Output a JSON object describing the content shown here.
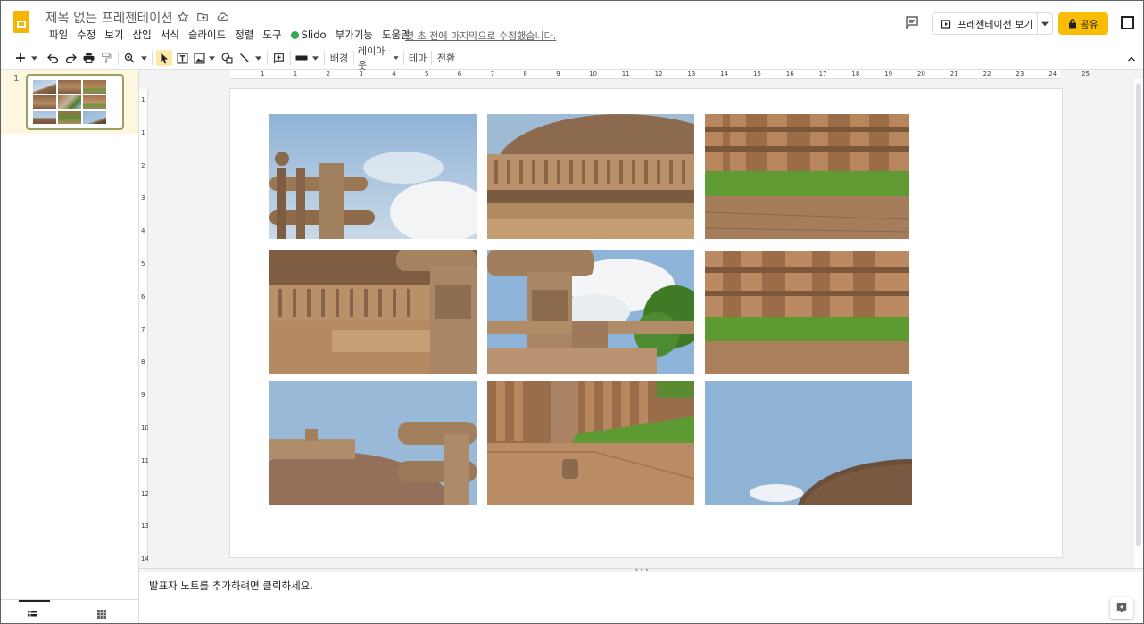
{
  "app": {
    "document_title": "제목 없는 프레젠테이션",
    "last_edit": "몇 초 전에 마지막으로 수정했습니다."
  },
  "menu": [
    "파일",
    "수정",
    "보기",
    "삽입",
    "서식",
    "슬라이드",
    "정렬",
    "도구",
    "Slido",
    "부가기능",
    "도움말"
  ],
  "header_buttons": {
    "present_label": "프레젠테이션 보기",
    "share_label": "공유"
  },
  "toolbar": {
    "background_label": "배경",
    "layout_label": "레이아웃",
    "theme_label": "테마",
    "transition_label": "전환"
  },
  "filmstrip": {
    "slide_number": "1"
  },
  "rulers": {
    "horizontal": [
      "1",
      "1",
      "2",
      "3",
      "4",
      "5",
      "6",
      "7",
      "8",
      "9",
      "10",
      "11",
      "12",
      "13",
      "14",
      "15",
      "16",
      "17",
      "18",
      "19",
      "20",
      "21",
      "22",
      "23",
      "24",
      "25"
    ],
    "vertical": [
      "1",
      "1",
      "2",
      "3",
      "4",
      "5",
      "6",
      "7",
      "8",
      "9",
      "10",
      "11",
      "12",
      "13",
      "14"
    ]
  },
  "slide": {
    "photos": [
      "stupa-gateway-sky",
      "stupa-dome-railing",
      "stone-railing-lawn",
      "stupa-railing-pillar",
      "gateway-pillar-tree",
      "stone-posts-lawn",
      "stupa-top-gateway",
      "carved-pillar-path",
      "dome-edge-sky"
    ]
  },
  "notes": {
    "placeholder": "발표자 노트를 추가하려면 클릭하세요."
  },
  "colors": {
    "accent_yellow": "#fbbc04",
    "filmstrip_selected_bg": "#fef7e0",
    "canvas_bg": "#f1f3f4"
  }
}
